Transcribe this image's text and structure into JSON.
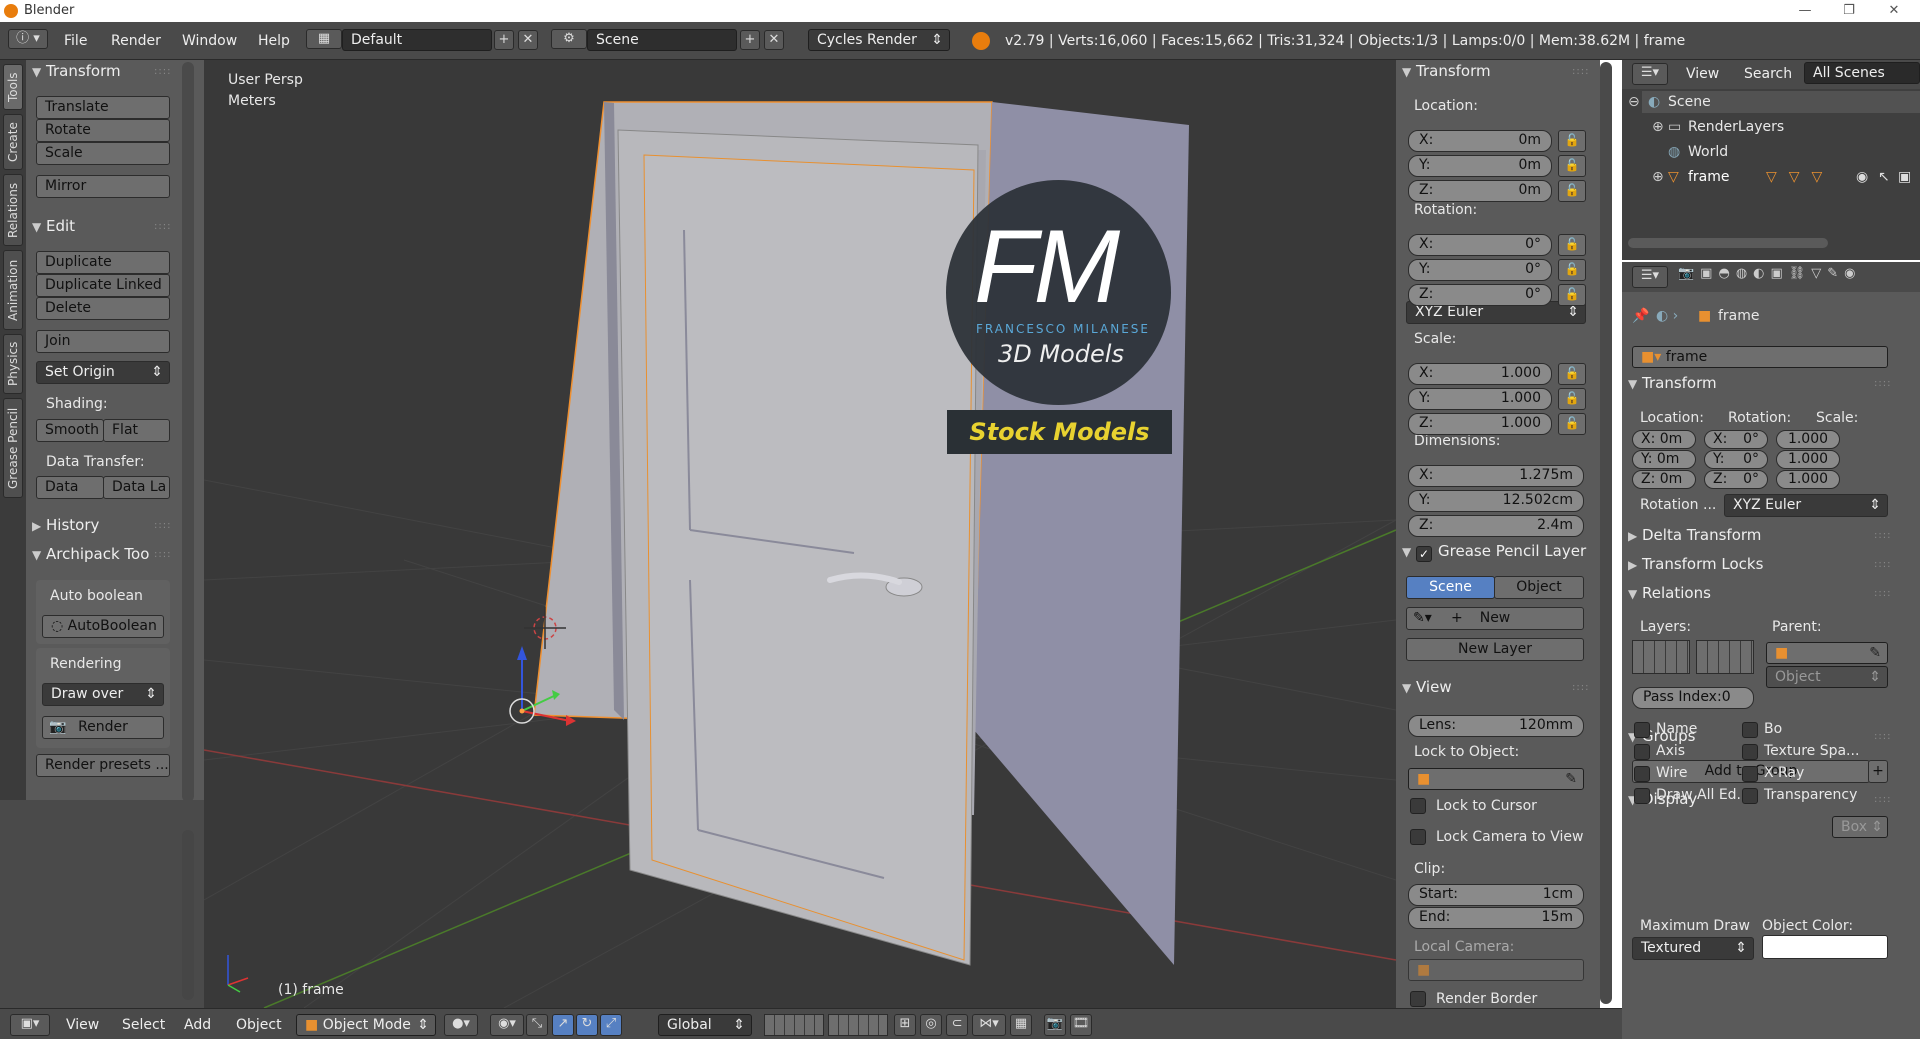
{
  "window": {
    "title": "Blender",
    "min": "—",
    "max": "❐",
    "close": "✕"
  },
  "topbar": {
    "menus": [
      "File",
      "Render",
      "Window",
      "Help"
    ],
    "screen_layout": "Default",
    "scene": "Scene",
    "engine": "Cycles Render",
    "info": "v2.79 | Verts:16,060 | Faces:15,662 | Tris:31,324 | Objects:1/3 | Lamps:0/0 | Mem:38.62M | frame"
  },
  "left_tabs": [
    "Tools",
    "Create",
    "Relations",
    "Animation",
    "Physics",
    "Grease Pencil"
  ],
  "toolshelf": {
    "transform": {
      "header": "Transform",
      "buttons": [
        "Translate",
        "Rotate",
        "Scale",
        "Mirror"
      ]
    },
    "edit": {
      "header": "Edit",
      "buttons": [
        "Duplicate",
        "Duplicate Linked",
        "Delete",
        "Join"
      ],
      "set_origin": "Set Origin",
      "shading_label": "Shading:",
      "smooth": "Smooth",
      "flat": "Flat",
      "data_transfer_label": "Data Transfer:",
      "data": "Data",
      "data_layers": "Data La"
    },
    "history": {
      "header": "History"
    },
    "archipack": {
      "header": "Archipack Too",
      "auto_boolean_label": "Auto boolean",
      "auto_boolean_btn": "AutoBoolean",
      "rendering_label": "Rendering",
      "draw_over": "Draw over",
      "render_btn": "Render",
      "render_presets": "Render presets ..."
    }
  },
  "viewport": {
    "view_name": "User Persp",
    "units": "Meters",
    "object_label": "(1) frame",
    "watermark": {
      "letters": "FM",
      "name": "FRANCESCO MILANESE",
      "tagline": "3D Models",
      "banner": "Stock Models"
    }
  },
  "npanel": {
    "transform_header": "Transform",
    "location_label": "Location:",
    "location": [
      {
        "k": "X:",
        "v": "0m"
      },
      {
        "k": "Y:",
        "v": "0m"
      },
      {
        "k": "Z:",
        "v": "0m"
      }
    ],
    "rotation_label": "Rotation:",
    "rotation": [
      {
        "k": "X:",
        "v": "0°"
      },
      {
        "k": "Y:",
        "v": "0°"
      },
      {
        "k": "Z:",
        "v": "0°"
      }
    ],
    "rotation_mode": "XYZ Euler",
    "scale_label": "Scale:",
    "scale": [
      {
        "k": "X:",
        "v": "1.000"
      },
      {
        "k": "Y:",
        "v": "1.000"
      },
      {
        "k": "Z:",
        "v": "1.000"
      }
    ],
    "dimensions_label": "Dimensions:",
    "dimensions": [
      {
        "k": "X:",
        "v": "1.275m"
      },
      {
        "k": "Y:",
        "v": "12.502cm"
      },
      {
        "k": "Z:",
        "v": "2.4m"
      }
    ],
    "gp_header": "Grease Pencil Layer",
    "gp_scene": "Scene",
    "gp_object": "Object",
    "gp_new": "New",
    "gp_new_layer": "New Layer",
    "view_header": "View",
    "lens_k": "Lens:",
    "lens_v": "120mm",
    "lock_to_object": "Lock to Object:",
    "lock_to_cursor": "Lock to Cursor",
    "lock_camera": "Lock Camera to View",
    "clip_label": "Clip:",
    "clip_start_k": "Start:",
    "clip_start_v": "1cm",
    "clip_end_k": "End:",
    "clip_end_v": "15m",
    "local_camera": "Local Camera:",
    "render_border": "Render Border"
  },
  "outliner": {
    "menu_view": "View",
    "menu_search": "Search",
    "filter": "All Scenes",
    "items": [
      "Scene",
      "RenderLayers",
      "World",
      "frame"
    ]
  },
  "props": {
    "breadcrumb": "frame",
    "object_name": "frame",
    "transform_header": "Transform",
    "loc_label": "Location:",
    "rot_label": "Rotation:",
    "scale_label": "Scale:",
    "loc": [
      "X: 0m",
      "Y: 0m",
      "Z: 0m"
    ],
    "rot": [
      "X:",
      "Y:",
      "Z:"
    ],
    "rot_v": [
      "0°",
      "0°",
      "0°"
    ],
    "scl": [
      "1.000",
      "1.000",
      "1.000"
    ],
    "rot_mode_label": "Rotation ...",
    "rot_mode": "XYZ Euler",
    "delta": "Delta Transform",
    "locks": "Transform Locks",
    "relations": "Relations",
    "layers_label": "Layers:",
    "parent_label": "Parent:",
    "parent_type": "Object",
    "pass_index": "Pass Index:0",
    "groups": "Groups",
    "add_to_group": "Add to Group",
    "display": "Display",
    "disp_left": [
      "Name",
      "Axis",
      "Wire",
      "Draw All Ed..."
    ],
    "disp_right": [
      "Bo",
      "Texture Spa...",
      "X-Ray",
      "Transparency"
    ],
    "box": "Box",
    "max_draw_label": "Maximum Draw",
    "object_color_label": "Object Color:",
    "max_draw": "Textured"
  },
  "bottombar": {
    "menus": [
      "View",
      "Select",
      "Add",
      "Object"
    ],
    "mode": "Object Mode",
    "orientation": "Global"
  }
}
